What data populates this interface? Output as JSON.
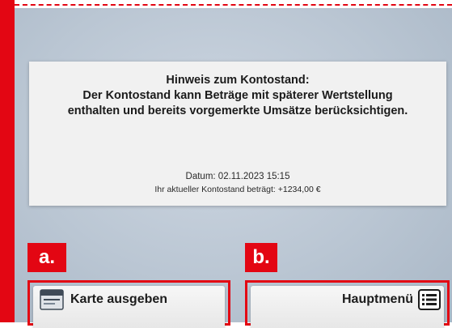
{
  "notice": {
    "line1": "Hinweis zum Kontostand:",
    "line2": "Der Kontostand kann Beträge mit späterer Wertstellung",
    "line3": "enthalten und bereits vorgemerkte Umsätze berücksichtigen.",
    "date": "Datum: 02.11.2023 15:15",
    "balance_label": "Ihr aktueller Kontostand beträgt:",
    "balance_value": "+1234,00 €"
  },
  "annotations": {
    "a": "a.",
    "b": "b."
  },
  "buttons": {
    "eject_card": {
      "label": "Karte ausgeben",
      "icon": "card-slot-icon"
    },
    "main_menu": {
      "label": "Hauptmenü",
      "icon": "menu-list-icon"
    }
  },
  "colors": {
    "accent_red": "#e30613",
    "screen_bg": "#bac6d3",
    "panel_bg": "#f1f1f1"
  }
}
